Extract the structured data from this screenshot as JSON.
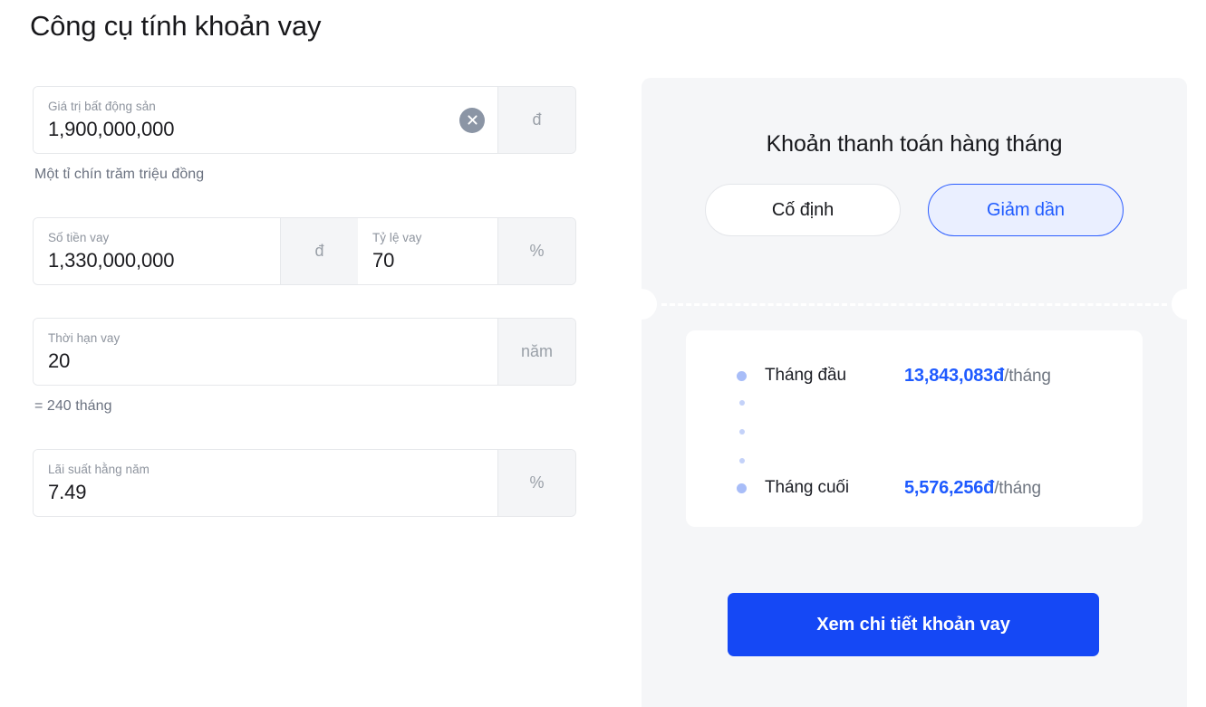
{
  "page": {
    "title": "Công cụ tính khoản vay"
  },
  "form": {
    "property_value": {
      "label": "Giá trị bất động sản",
      "value": "1,900,000,000",
      "suffix": "đ",
      "clear_icon": "close-circle-icon",
      "helper": "Một tỉ chín trăm triệu đồng"
    },
    "loan_amount": {
      "label": "Số tiền vay",
      "value": "1,330,000,000",
      "suffix": "đ"
    },
    "loan_ratio": {
      "label": "Tỷ lệ vay",
      "value": "70",
      "suffix": "%"
    },
    "loan_term": {
      "label": "Thời hạn vay",
      "value": "20",
      "suffix": "năm",
      "helper": "= 240 tháng"
    },
    "interest_rate": {
      "label": "Lãi suất hằng năm",
      "value": "7.49",
      "suffix": "%"
    }
  },
  "result": {
    "title": "Khoản thanh toán hàng tháng",
    "toggles": [
      {
        "label": "Cố định",
        "selected": false
      },
      {
        "label": "Giảm dần",
        "selected": true
      }
    ],
    "rows": [
      {
        "label": "Tháng đầu",
        "amount": "13,843,083đ",
        "period": "/tháng"
      },
      {
        "label": "Tháng cuối",
        "amount": "5,576,256đ",
        "period": "/tháng"
      }
    ],
    "cta_label": "Xem chi tiết khoản vay"
  },
  "colors": {
    "accent_blue": "#1548f5",
    "amount_blue": "#1f5bff",
    "toggle_active_bg": "#eaefff",
    "panel_bg": "#f5f6f8",
    "suffix_bg": "#f4f5f7",
    "dot_blue": "#a8bdf8"
  }
}
